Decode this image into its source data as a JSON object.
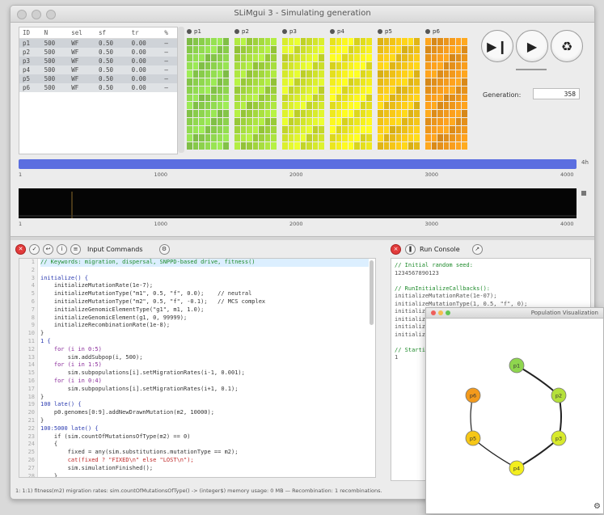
{
  "window": {
    "title": "SLiMgui 3 - Simulating generation"
  },
  "populations_table": {
    "headers": [
      "ID",
      "N",
      "sel",
      "sf",
      "tr",
      "%"
    ],
    "rows": [
      [
        "p1",
        "500",
        "WF",
        "0.50",
        "0.00",
        "—"
      ],
      [
        "p2",
        "500",
        "WF",
        "0.50",
        "0.00",
        "—"
      ],
      [
        "p3",
        "500",
        "WF",
        "0.50",
        "0.00",
        "—"
      ],
      [
        "p4",
        "500",
        "WF",
        "0.50",
        "0.00",
        "—"
      ],
      [
        "p5",
        "500",
        "WF",
        "0.50",
        "0.00",
        "—"
      ],
      [
        "p6",
        "500",
        "WF",
        "0.50",
        "0.00",
        "—"
      ]
    ]
  },
  "population_views": [
    {
      "label": "p1",
      "color": "#8fd64e"
    },
    {
      "label": "p2",
      "color": "#a6dc3e"
    },
    {
      "label": "p3",
      "color": "#d6ea2c"
    },
    {
      "label": "p4",
      "color": "#f3ee1f"
    },
    {
      "label": "p5",
      "color": "#f6c717"
    },
    {
      "label": "p6",
      "color": "#f39a1c"
    }
  ],
  "controls": {
    "step_icon": "step-icon",
    "play_icon": "play-icon",
    "recycle_icon": "recycle-icon",
    "generation_label": "Generation:",
    "generation_value": "358"
  },
  "timeline": {
    "ticks": [
      "1",
      "1000",
      "2000",
      "3000",
      "4000"
    ],
    "end_label": "4h"
  },
  "editor": {
    "toolbar_label": "Input Commands",
    "lines": [
      {
        "n": "1",
        "text": "// Keywords: migration, dispersal, SNPPD-based drive, fitness()",
        "cls": "c-green hl"
      },
      {
        "n": "2",
        "text": "",
        "cls": ""
      },
      {
        "n": "3",
        "text": "initialize() {",
        "cls": "c-blue"
      },
      {
        "n": "4",
        "text": "    initializeMutationRate(1e-7);",
        "cls": ""
      },
      {
        "n": "5",
        "text": "    initializeMutationType(\"m1\", 0.5, \"f\", 0.0);    // neutral",
        "cls": ""
      },
      {
        "n": "6",
        "text": "    initializeMutationType(\"m2\", 0.5, \"f\", -0.1);   // MCS complex",
        "cls": ""
      },
      {
        "n": "7",
        "text": "    initializeGenomicElementType(\"g1\", m1, 1.0);",
        "cls": ""
      },
      {
        "n": "8",
        "text": "    initializeGenomicElement(g1, 0, 99999);",
        "cls": ""
      },
      {
        "n": "9",
        "text": "    initializeRecombinationRate(1e-8);",
        "cls": ""
      },
      {
        "n": "10",
        "text": "}",
        "cls": ""
      },
      {
        "n": "11",
        "text": "1 {",
        "cls": "c-blue"
      },
      {
        "n": "12",
        "text": "    for (i in 0:5)",
        "cls": "c-purple"
      },
      {
        "n": "13",
        "text": "        sim.addSubpop(i, 500);",
        "cls": ""
      },
      {
        "n": "14",
        "text": "    for (i in 1:5)",
        "cls": "c-purple"
      },
      {
        "n": "15",
        "text": "        sim.subpopulations[i].setMigrationRates(i-1, 0.001);",
        "cls": ""
      },
      {
        "n": "16",
        "text": "    for (i in 0:4)",
        "cls": "c-purple"
      },
      {
        "n": "17",
        "text": "        sim.subpopulations[i].setMigrationRates(i+1, 0.1);",
        "cls": ""
      },
      {
        "n": "18",
        "text": "}",
        "cls": ""
      },
      {
        "n": "19",
        "text": "100 late() {",
        "cls": "c-blue"
      },
      {
        "n": "20",
        "text": "    p0.genomes[0:9].addNewDrawnMutation(m2, 10000);",
        "cls": ""
      },
      {
        "n": "21",
        "text": "}",
        "cls": ""
      },
      {
        "n": "22",
        "text": "100:5000 late() {",
        "cls": "c-blue"
      },
      {
        "n": "23",
        "text": "    if (sim.countOfMutationsOfType(m2) == 0)",
        "cls": ""
      },
      {
        "n": "24",
        "text": "    {",
        "cls": ""
      },
      {
        "n": "25",
        "text": "        fixed = any(sim.substitutions.mutationType == m2);",
        "cls": ""
      },
      {
        "n": "26",
        "text": "        cat(fixed ? \"FIXED\\n\" else \"LOST\\n\");",
        "cls": "c-red"
      },
      {
        "n": "27",
        "text": "        sim.simulationFinished();",
        "cls": ""
      },
      {
        "n": "28",
        "text": "    }",
        "cls": ""
      },
      {
        "n": "29",
        "text": "}",
        "cls": ""
      }
    ],
    "status_text": "1: 1:1) fitness(m2) migration rates: sim.countOfMutationsOfType() -> (integer$) memory usage: 0 MB — Recombination: 1 recombinations."
  },
  "output": {
    "toolbar_label": "Run Console",
    "lines": [
      {
        "text": "// Initial random seed:",
        "cls": "out-green"
      },
      {
        "text": "1234567890123",
        "cls": ""
      },
      {
        "text": "",
        "cls": ""
      },
      {
        "text": "// RunInitializeCallbacks():",
        "cls": "out-green"
      },
      {
        "text": "initializeMutationRate(1e-07);",
        "cls": ""
      },
      {
        "text": "initializeMutationType(1, 0.5, \"f\", 0);",
        "cls": ""
      },
      {
        "text": "initializeMutationType(2, 0.5, \"f\", -0.1);",
        "cls": ""
      },
      {
        "text": "initializeGenomicElementType(1, m1, 1);",
        "cls": ""
      },
      {
        "text": "initializeGenomicElement(g1, 0, 99999);",
        "cls": ""
      },
      {
        "text": "initializeRecombinationRate(1e-08);",
        "cls": ""
      },
      {
        "text": "",
        "cls": ""
      },
      {
        "text": "// Starting run at generation <start>:",
        "cls": "out-green"
      },
      {
        "text": "1",
        "cls": ""
      }
    ]
  },
  "graph_popup": {
    "title": "Population Visualization",
    "nodes": [
      {
        "label": "p1",
        "color": "#8fd64e"
      },
      {
        "label": "p2",
        "color": "#b4e03a"
      },
      {
        "label": "p3",
        "color": "#d8ea2c"
      },
      {
        "label": "p4",
        "color": "#f3ee1f"
      },
      {
        "label": "p5",
        "color": "#f6c717"
      },
      {
        "label": "p6",
        "color": "#f39a1c"
      }
    ]
  }
}
